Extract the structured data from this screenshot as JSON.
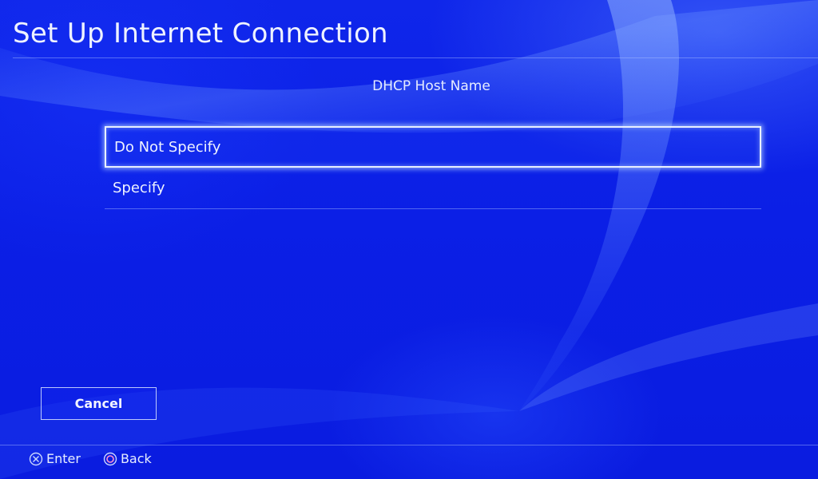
{
  "screen": {
    "title": "Set Up Internet Connection",
    "subtitle": "DHCP Host Name"
  },
  "options": [
    {
      "label": "Do Not Specify",
      "selected": true
    },
    {
      "label": "Specify",
      "selected": false
    }
  ],
  "cancel_label": "Cancel",
  "footer": {
    "enter_label": "Enter",
    "enter_icon": "cross-button-icon",
    "back_label": "Back",
    "back_icon": "circle-button-icon"
  },
  "colors": {
    "background": "#0a1ee6",
    "text": "#eef2ff",
    "highlight": "#e8efff"
  }
}
